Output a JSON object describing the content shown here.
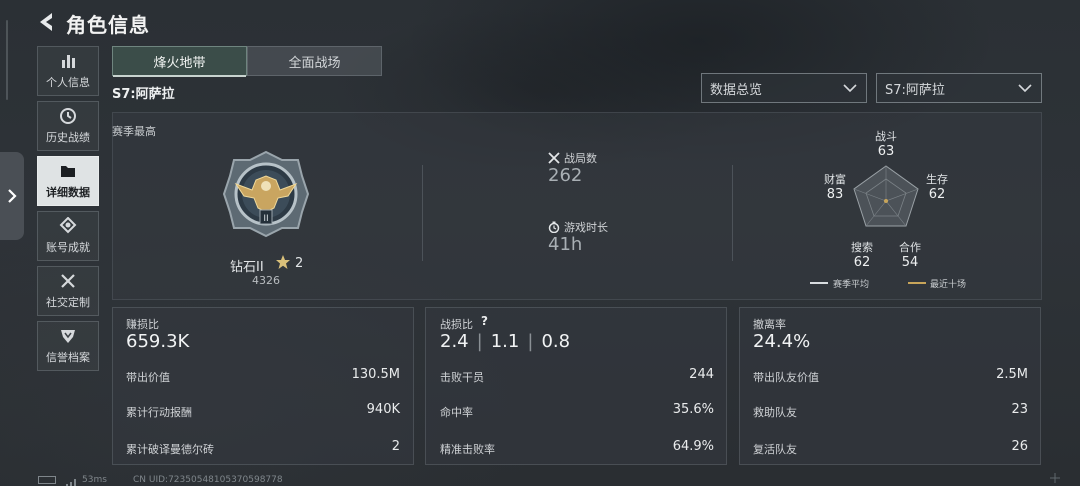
{
  "header": {
    "title": "角色信息"
  },
  "sidebar": {
    "items": [
      {
        "label": "个人信息",
        "icon": "bar-chart-icon"
      },
      {
        "label": "历史战绩",
        "icon": "history-icon"
      },
      {
        "label": "详细数据",
        "icon": "folder-icon",
        "active": true
      },
      {
        "label": "账号成就",
        "icon": "achievement-icon"
      },
      {
        "label": "社交定制",
        "icon": "tools-icon"
      },
      {
        "label": "信誉档案",
        "icon": "shield-icon"
      }
    ]
  },
  "tabs": [
    {
      "label": "烽火地带",
      "active": true
    },
    {
      "label": "全面战场",
      "active": false
    }
  ],
  "season": {
    "label": "S7:阿萨拉"
  },
  "filters": {
    "overview": "数据总览",
    "season": "S7:阿萨拉"
  },
  "panel": {
    "season_high_label": "赛季最高",
    "rank": {
      "name": "钻石II",
      "stars": "2",
      "score": "4326"
    },
    "matches": {
      "label": "战局数",
      "value": "262"
    },
    "playtime": {
      "label": "游戏时长",
      "value": "41h"
    },
    "radar": {
      "axes": [
        {
          "label": "战斗",
          "value": 63
        },
        {
          "label": "生存",
          "value": 62
        },
        {
          "label": "合作",
          "value": 54
        },
        {
          "label": "搜索",
          "value": 62
        },
        {
          "label": "财富",
          "value": 83
        }
      ],
      "legend": [
        {
          "label": "赛季平均",
          "color": "#d8dcdf"
        },
        {
          "label": "最近十场",
          "color": "#c8a55a"
        }
      ]
    }
  },
  "cards": [
    {
      "title": "赚损比",
      "big": "659.3K",
      "rows": [
        {
          "label": "带出价值",
          "value": "130.5M"
        },
        {
          "label": "累计行动报酬",
          "value": "940K"
        },
        {
          "label": "累计破译曼德尔砖",
          "value": "2"
        }
      ]
    },
    {
      "title": "战损比",
      "help": "?",
      "big_parts": [
        "2.4",
        "1.1",
        "0.8"
      ],
      "rows": [
        {
          "label": "击败干员",
          "value": "244"
        },
        {
          "label": "命中率",
          "value": "35.6%"
        },
        {
          "label": "精准击败率",
          "value": "64.9%"
        }
      ]
    },
    {
      "title": "撤离率",
      "big": "24.4%",
      "rows": [
        {
          "label": "带出队友价值",
          "value": "2.5M"
        },
        {
          "label": "救助队友",
          "value": "23"
        },
        {
          "label": "复活队友",
          "value": "26"
        }
      ]
    }
  ],
  "footer": {
    "ping": "53ms",
    "uid": "CN UID:72350548105370598778"
  }
}
